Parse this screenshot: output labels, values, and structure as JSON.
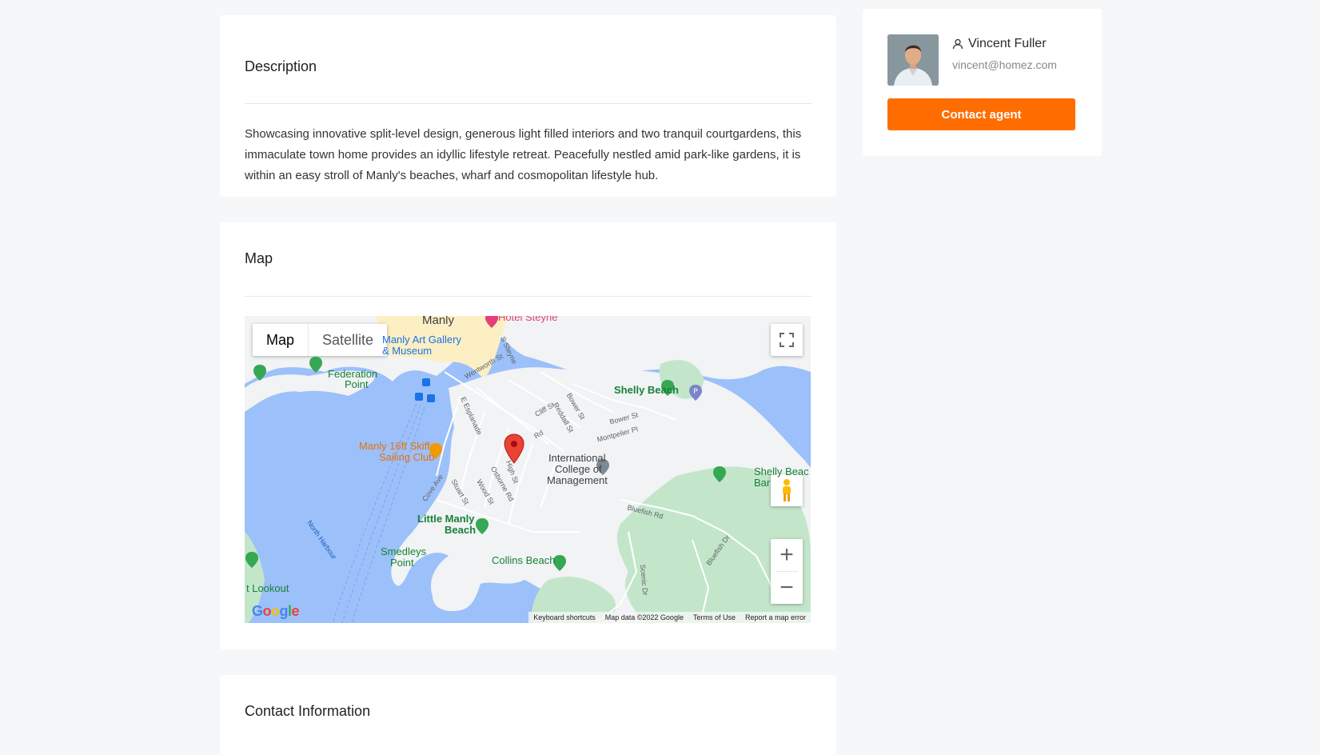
{
  "description": {
    "title": "Description",
    "text": "Showcasing innovative split-level design, generous light filled interiors and two tranquil courtgardens, this immaculate town home provides an idyllic lifestyle retreat. Peacefully nestled amid park-like gardens, it is within an easy stroll of Manly's beaches, wharf and cosmopolitan lifestyle hub."
  },
  "map": {
    "title": "Map",
    "type_map": "Map",
    "type_satellite": "Satellite",
    "labels": {
      "manly": "Manly",
      "hotel": "Hotel Steyne",
      "gallery1": "Manly Art Gallery",
      "gallery2": "& Museum",
      "federation1": "Federation",
      "federation2": "Point",
      "shelly": "Shelly Beach",
      "skiff1": "Manly 16ft Skiff",
      "skiff2": "Sailing Club",
      "icm1": "International",
      "icm2": "College of",
      "icm3": "Management",
      "shelly_bar1": "Shelly Beac",
      "shelly_bar2": "Bar",
      "little1": "Little Manly",
      "little2": "Beach",
      "smedleys1": "Smedleys",
      "smedleys2": "Point",
      "collins": "Collins Beach",
      "lookout": "t Lookout",
      "north_harbour": "North Harbour"
    },
    "streets": {
      "wentworth": "Wentworth St",
      "steyne": "S Steyne",
      "cliff": "Cliff St",
      "bower": "Bower St",
      "bower2": "Bower St",
      "reddall": "Reddall St",
      "montpelier": "Montpelier Pl",
      "esplanade": "E Esplanade",
      "rd": "Rd",
      "high": "High St",
      "osborne": "Osborne Rd",
      "wood": "Wood St",
      "stuart": "Stuart St",
      "cove": "Cove Ave",
      "bluefish": "Bluefish Rd",
      "bluefish_dr": "Bluefish Dr",
      "scenic": "Scenic Dr"
    },
    "google": "Google",
    "footer": {
      "shortcuts": "Keyboard shortcuts",
      "data": "Map data ©2022 Google",
      "terms": "Terms of Use",
      "report": "Report a map error"
    }
  },
  "contact": {
    "title": "Contact Information"
  },
  "agent": {
    "name": "Vincent Fuller",
    "email": "vincent@homez.com",
    "button": "Contact agent"
  },
  "colors": {
    "accent": "#ff6d00",
    "water": "#9cc0f9",
    "land": "#f1f3f4",
    "park": "#c3e6cb"
  }
}
